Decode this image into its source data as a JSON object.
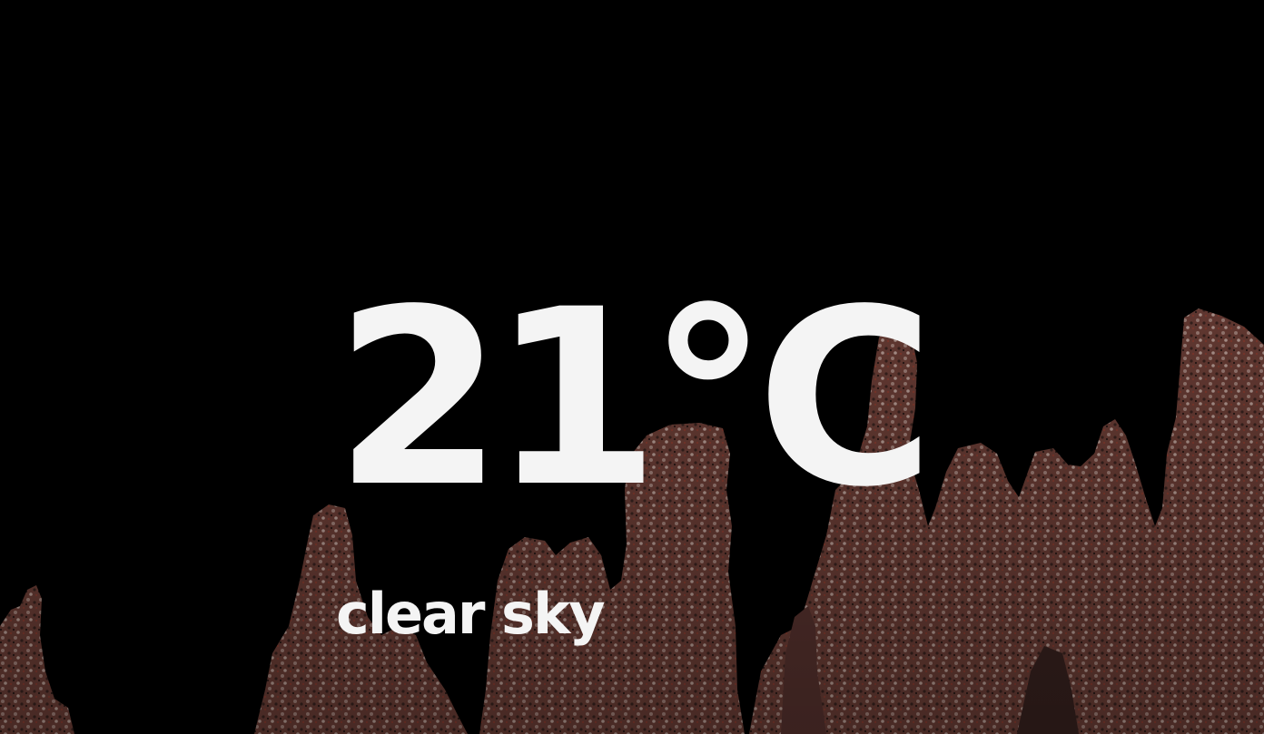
{
  "weather": {
    "temperature": "21°C",
    "condition": "clear sky"
  },
  "background": {
    "image": "tufa-rock-formations",
    "sky_color": "#000000",
    "rock_color": "#7a4a40",
    "text_color": "#f4f4f4"
  }
}
